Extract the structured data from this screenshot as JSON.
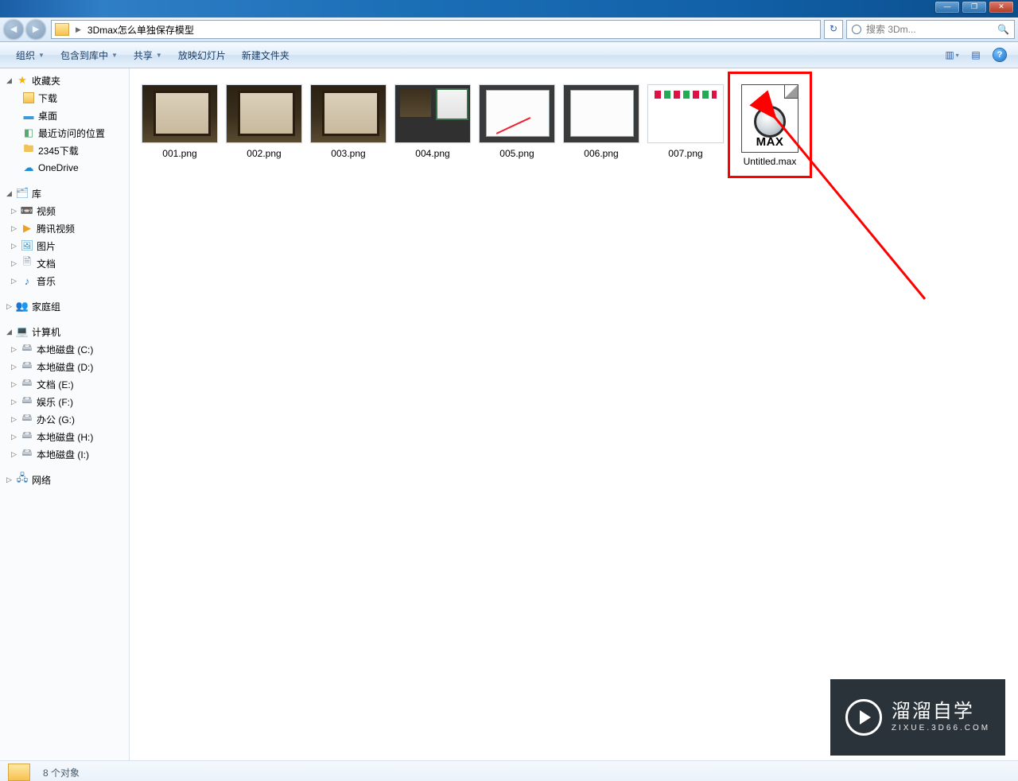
{
  "window": {
    "minimize": "—",
    "maximize": "❐",
    "close": "✕"
  },
  "address": {
    "crumb1": "3Dmax怎么单独保存模型"
  },
  "search": {
    "placeholder": "搜索 3Dm..."
  },
  "search_suffix_icon": "🔍",
  "refresh_icon": "↻",
  "nav_back": "◄",
  "nav_fwd": "►",
  "toolbar": {
    "organize": "组织",
    "include": "包含到库中",
    "share": "共享",
    "slideshow": "放映幻灯片",
    "new_folder": "新建文件夹",
    "views_drop": "▾",
    "help": "?"
  },
  "dropdown_mark": "▼",
  "nav": {
    "favorites": "收藏夹",
    "downloads": "下载",
    "desktop": "桌面",
    "recent_places": "最近访问的位置",
    "dl2345": "2345下载",
    "onedrive": "OneDrive",
    "libraries": "库",
    "videos": "视频",
    "tencent_video": "腾讯视频",
    "pictures": "图片",
    "documents": "文档",
    "music": "音乐",
    "homegroup": "家庭组",
    "computer": "计算机",
    "disk_c": "本地磁盘 (C:)",
    "disk_d": "本地磁盘 (D:)",
    "disk_e": "文档 (E:)",
    "disk_f": "娱乐 (F:)",
    "disk_g": "办公 (G:)",
    "disk_h": "本地磁盘 (H:)",
    "disk_i": "本地磁盘 (I:)",
    "network": "网络"
  },
  "twisty_open": "◢",
  "twisty_closed": "▷",
  "files": {
    "f1": "001.png",
    "f2": "002.png",
    "f3": "003.png",
    "f4": "004.png",
    "f5": "005.png",
    "f6": "006.png",
    "f7": "007.png",
    "f8": "Untitled.max"
  },
  "status": {
    "count": "8 个对象"
  },
  "watermark": {
    "main": "溜溜自学",
    "sub": "ZIXUE.3D66.COM"
  },
  "thumb_views_icon": "▥",
  "thumb_preview_icon": "▤"
}
